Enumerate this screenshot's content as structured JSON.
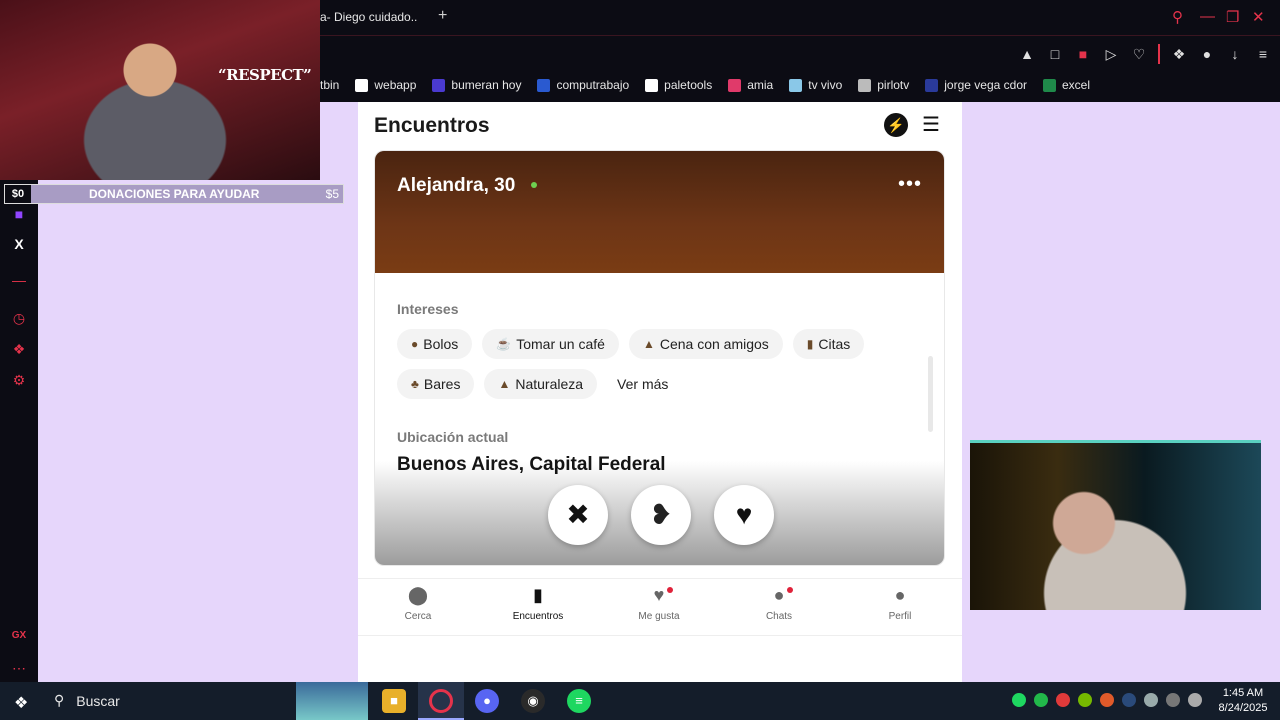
{
  "browser": {
    "tab_title": "a- Diego cuidado..",
    "tab_add": "+",
    "bookmarks": [
      {
        "label": "tbin",
        "color": ""
      },
      {
        "label": "webapp",
        "color": "#ffffff"
      },
      {
        "label": "bumeran hoy",
        "color": "#4a3ad0"
      },
      {
        "label": "computrabajo",
        "color": "#2a5ad0"
      },
      {
        "label": "paletools",
        "color": "#ffffff"
      },
      {
        "label": "amia",
        "color": "#e03a6a"
      },
      {
        "label": "tv vivo",
        "color": "#8ac8e8"
      },
      {
        "label": "pirlotv",
        "color": "#bbbbbb"
      },
      {
        "label": "jorge vega cdor",
        "color": "#2a3a9a"
      },
      {
        "label": "excel",
        "color": "#1f8a4a"
      }
    ]
  },
  "overlay": {
    "respect_text": "“RESPECT”",
    "donations": {
      "left": "$0",
      "title": "DONACIONES PARA AYUDAR",
      "right": "$5"
    }
  },
  "page": {
    "title": "Encuentros",
    "profile": {
      "name_age": "Alejandra, 30",
      "more": "•••"
    },
    "interests_title": "Intereses",
    "interests": [
      {
        "icon": "bowling-icon",
        "glyph": "●",
        "label": "Bolos"
      },
      {
        "icon": "coffee-icon",
        "glyph": "☕",
        "label": "Tomar un café"
      },
      {
        "icon": "dinner-icon",
        "glyph": "▲",
        "label": "Cena con amigos"
      },
      {
        "icon": "date-icon",
        "glyph": "▮",
        "label": "Citas"
      },
      {
        "icon": "bar-icon",
        "glyph": "♣",
        "label": "Bares"
      },
      {
        "icon": "tree-icon",
        "glyph": "▲",
        "label": "Naturaleza"
      }
    ],
    "see_more": "Ver más",
    "location_title": "Ubicación actual",
    "location_value": "Buenos Aires, Capital Federal"
  },
  "nav": [
    {
      "label": "Cerca",
      "icon": "location-pin-icon",
      "glyph": "⬤",
      "badge": false
    },
    {
      "label": "Encuentros",
      "icon": "cards-icon",
      "glyph": "▮",
      "badge": false
    },
    {
      "label": "Me gusta",
      "icon": "heart-bubble-icon",
      "glyph": "♥",
      "badge": true
    },
    {
      "label": "Chats",
      "icon": "chat-bubble-icon",
      "glyph": "●",
      "badge": true
    },
    {
      "label": "Perfil",
      "icon": "person-icon",
      "glyph": "●",
      "badge": false
    }
  ],
  "taskbar": {
    "search": "Buscar",
    "time": "1:45 AM",
    "date": "8/24/2025"
  }
}
